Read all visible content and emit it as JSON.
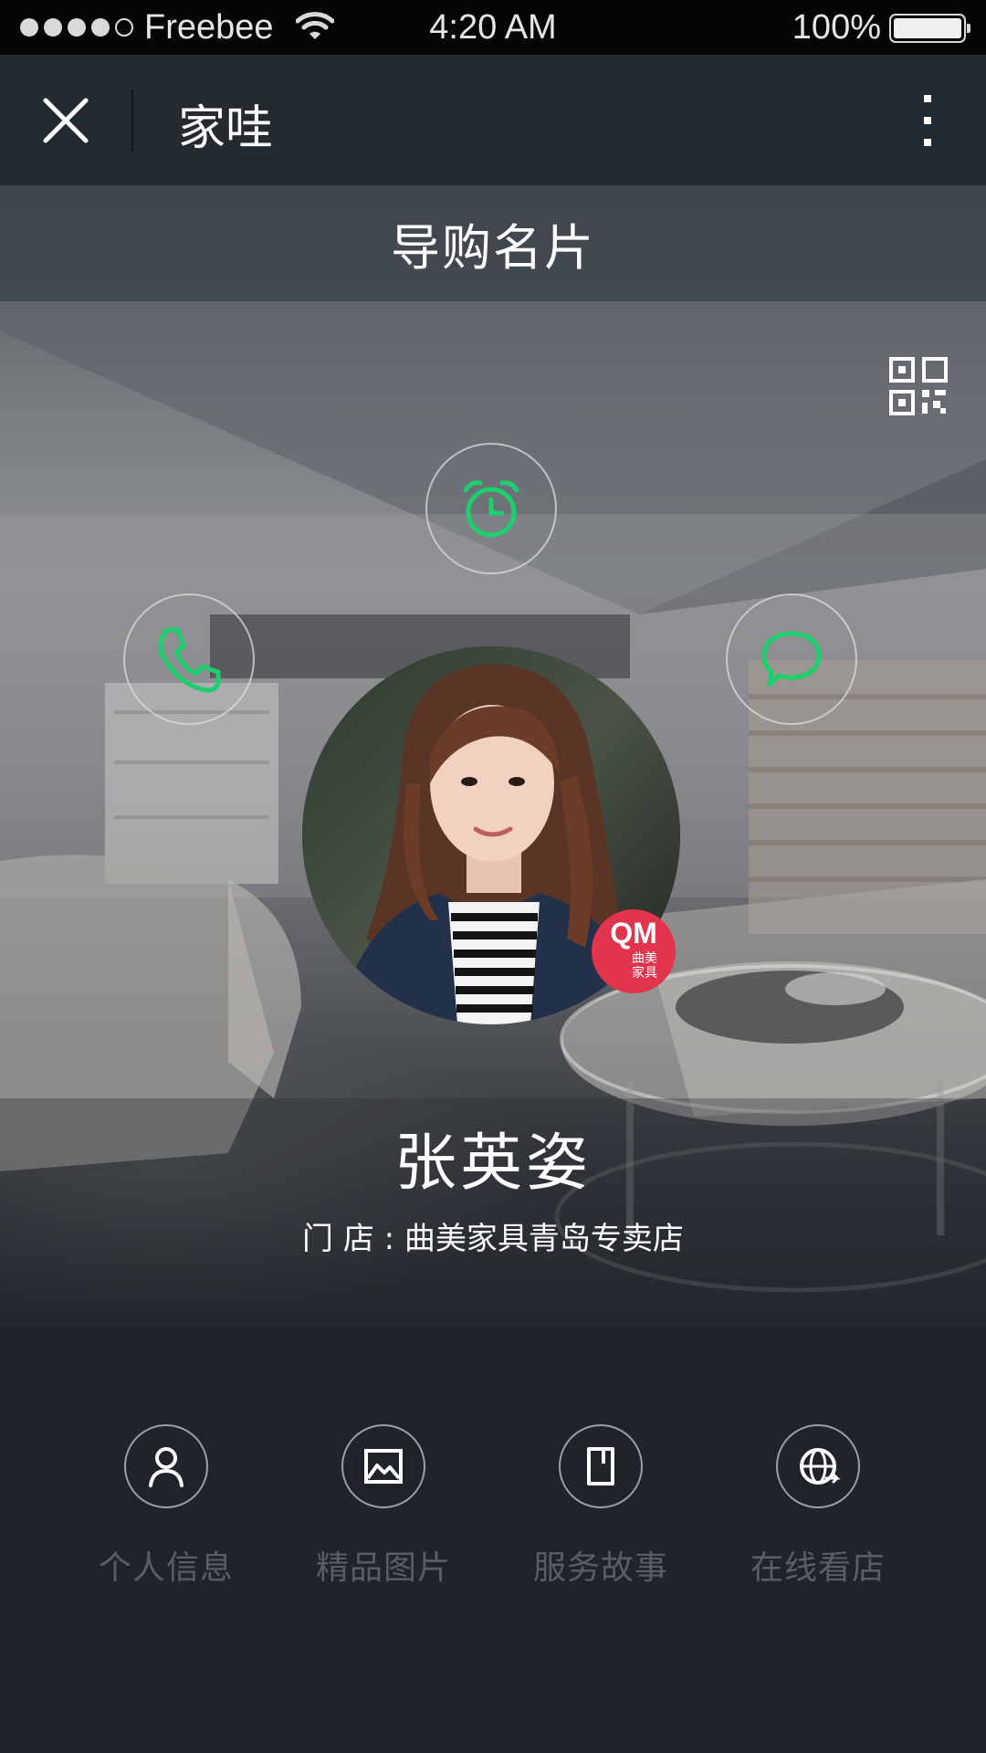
{
  "status_bar": {
    "carrier": "Freebee",
    "time": "4:20 AM",
    "battery": "100%",
    "signal_bars": 4
  },
  "nav": {
    "title": "家哇",
    "close_icon": "close-icon",
    "more_icon": "more-vertical-icon"
  },
  "card": {
    "title": "导购名片",
    "qr_icon": "qr-code-icon",
    "actions": [
      {
        "name": "alarm",
        "icon": "alarm-clock-icon"
      },
      {
        "name": "phone",
        "icon": "phone-icon"
      },
      {
        "name": "chat",
        "icon": "chat-bubble-icon"
      }
    ],
    "badge": {
      "text": "QM",
      "sub": "曲美家具"
    },
    "name": "张英姿",
    "store": "门 店 : 曲美家具青岛专卖店",
    "accent_color": "#1fce6d"
  },
  "menu": [
    {
      "label": "个人信息",
      "icon": "person-icon"
    },
    {
      "label": "精品图片",
      "icon": "image-icon"
    },
    {
      "label": "服务故事",
      "icon": "book-icon"
    },
    {
      "label": "在线看店",
      "icon": "globe-icon"
    }
  ]
}
